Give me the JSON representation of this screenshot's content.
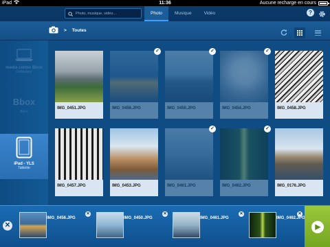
{
  "statusbar": {
    "device": "iPad",
    "time": "11:36",
    "battery_text": "Aucune recharge en cours"
  },
  "search": {
    "placeholder": "Photo, musique, vidéo..."
  },
  "tabs": [
    {
      "label": "Photo",
      "active": true
    },
    {
      "label": "Musique",
      "active": false
    },
    {
      "label": "Vidéo",
      "active": false
    }
  ],
  "toolbar": {
    "breadcrumb_sep": ">",
    "breadcrumb": "Toutes"
  },
  "devices": [
    {
      "name": "media center Bbox",
      "sub": "Ordinateur"
    },
    {
      "name": "Bbox",
      "sub": "Bbox"
    },
    {
      "name": "iPad - YLS",
      "sub": "Tablette"
    }
  ],
  "photos": [
    {
      "label": "IMG_0451.JPG",
      "selected": false
    },
    {
      "label": "IMG_0456.JPG",
      "selected": true
    },
    {
      "label": "IMG_0450.JPG",
      "selected": true
    },
    {
      "label": "IMG_0454.JPG",
      "selected": true
    },
    {
      "label": "IMG_0458.JPG",
      "selected": false
    },
    {
      "label": "IMG_0457.JPG",
      "selected": false
    },
    {
      "label": "IMG_0453.JPG",
      "selected": false
    },
    {
      "label": "IMG_0461.JPG",
      "selected": true
    },
    {
      "label": "IMG_0462.JPG",
      "selected": true
    },
    {
      "label": "IMG_0176.JPG",
      "selected": false
    }
  ],
  "tray": [
    {
      "label": "IMG_0456.JPG"
    },
    {
      "label": "IMG_0450.JPG"
    },
    {
      "label": "IMG_0461.JPG"
    },
    {
      "label": "IMG_0462.JPG"
    }
  ],
  "colors": {
    "accent": "#3fa0ff",
    "next_button": "#8cbd32",
    "background": "#0f4c84"
  },
  "icons": [
    "search-icon",
    "help-icon",
    "settings-icon",
    "camera-icon",
    "refresh-icon",
    "grid-view-icon",
    "list-view-icon",
    "checkmark-icon",
    "close-icon",
    "next-arrow-icon"
  ]
}
